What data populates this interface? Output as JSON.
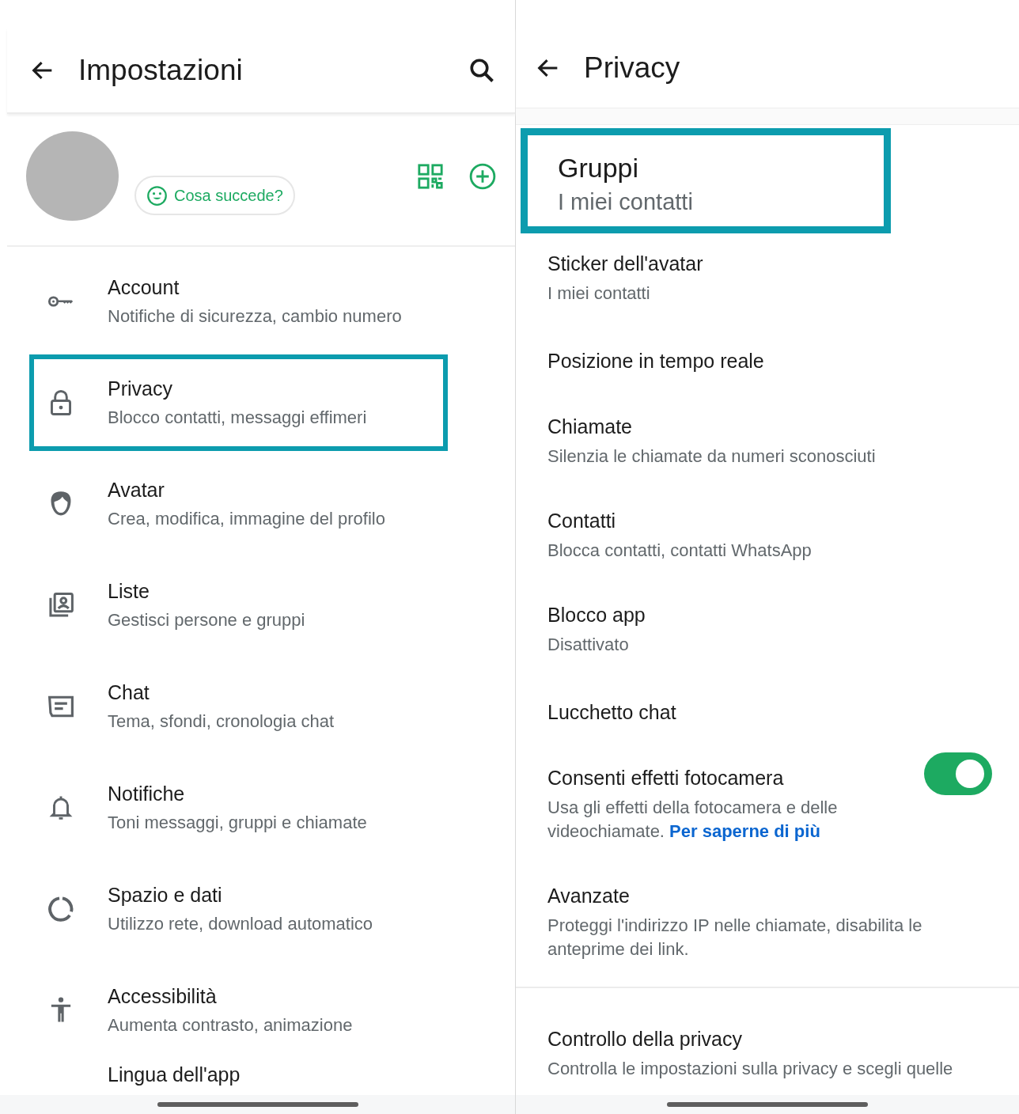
{
  "settings": {
    "title": "Impostazioni",
    "status_button": "Cosa succede?",
    "items": [
      {
        "title": "Account",
        "subtitle": "Notifiche di sicurezza, cambio numero",
        "highlighted": false
      },
      {
        "title": "Privacy",
        "subtitle": "Blocco contatti, messaggi effimeri",
        "highlighted": true
      },
      {
        "title": "Avatar",
        "subtitle": "Crea, modifica, immagine del profilo",
        "highlighted": false
      },
      {
        "title": "Liste",
        "subtitle": "Gestisci persone e gruppi",
        "highlighted": false
      },
      {
        "title": "Chat",
        "subtitle": "Tema, sfondi, cronologia chat",
        "highlighted": false
      },
      {
        "title": "Notifiche",
        "subtitle": "Toni messaggi, gruppi e chiamate",
        "highlighted": false
      },
      {
        "title": "Spazio e dati",
        "subtitle": "Utilizzo rete, download automatico",
        "highlighted": false
      },
      {
        "title": "Accessibilità",
        "subtitle": "Aumenta contrasto, animazione",
        "highlighted": false
      },
      {
        "title": "Lingua dell'app",
        "highlighted": false
      }
    ]
  },
  "privacy": {
    "title": "Privacy",
    "items": [
      {
        "kind": "text",
        "title": "Gruppi",
        "subtitle": "I miei contatti",
        "highlighted": true
      },
      {
        "kind": "text",
        "title": "Sticker dell'avatar",
        "subtitle": "I miei contatti",
        "highlighted": false
      },
      {
        "kind": "text",
        "title": "Posizione in tempo reale",
        "highlighted": false
      },
      {
        "kind": "text",
        "title": "Chiamate",
        "subtitle": "Silenzia le chiamate da numeri sconosciuti",
        "highlighted": false
      },
      {
        "kind": "text",
        "title": "Contatti",
        "subtitle": "Blocca contatti, contatti WhatsApp",
        "highlighted": false
      },
      {
        "kind": "text",
        "title": "Blocco app",
        "subtitle": "Disattivato",
        "highlighted": false
      },
      {
        "kind": "text",
        "title": "Lucchetto chat",
        "highlighted": false
      },
      {
        "kind": "toggle",
        "title": "Consenti effetti fotocamera",
        "subtitle": "Usa gli effetti della fotocamera e delle videochiamate.",
        "link": "Per saperne di più",
        "on": true,
        "highlighted": false
      },
      {
        "kind": "text",
        "title": "Avanzate",
        "subtitle": "Proteggi l'indirizzo IP nelle chiamate, disabilita le anteprime dei link.",
        "highlighted": false
      },
      {
        "kind": "divider"
      },
      {
        "kind": "text",
        "title": "Controllo della privacy",
        "subtitle": "Controlla le impostazioni sulla privacy e scegli quelle",
        "highlighted": false
      }
    ]
  }
}
